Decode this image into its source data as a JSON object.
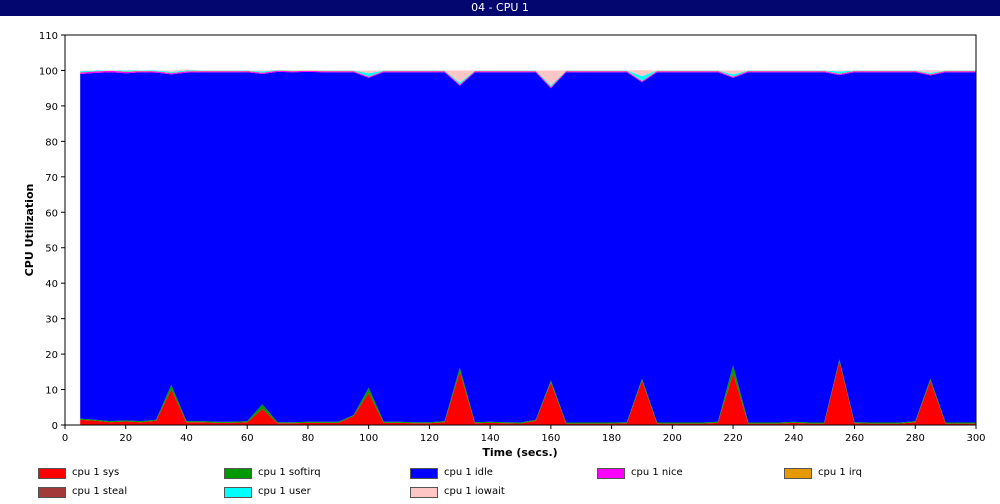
{
  "window": {
    "title": "04 - CPU 1"
  },
  "chart_data": {
    "type": "area",
    "stacked": true,
    "title": "",
    "xlabel": "Time (secs.)",
    "ylabel": "CPU Utilization",
    "xlim": [
      0,
      300
    ],
    "ylim": [
      0,
      110
    ],
    "xticks": [
      0,
      20,
      40,
      60,
      80,
      100,
      120,
      140,
      160,
      180,
      200,
      220,
      240,
      260,
      280,
      300
    ],
    "yticks": [
      0,
      10,
      20,
      30,
      40,
      50,
      60,
      70,
      80,
      90,
      100,
      110
    ],
    "grid": false,
    "legend_position": "bottom",
    "x": [
      5,
      10,
      15,
      20,
      25,
      30,
      35,
      40,
      45,
      50,
      55,
      60,
      65,
      70,
      75,
      80,
      85,
      90,
      95,
      100,
      105,
      110,
      115,
      120,
      125,
      130,
      135,
      140,
      145,
      150,
      155,
      160,
      165,
      170,
      175,
      180,
      185,
      190,
      195,
      200,
      205,
      210,
      215,
      220,
      225,
      230,
      235,
      240,
      245,
      250,
      255,
      260,
      265,
      270,
      275,
      280,
      285,
      290,
      295,
      300
    ],
    "series": [
      {
        "name": "cpu 1 sys",
        "color": "#ff0000",
        "values": [
          1.5,
          1.2,
          0.8,
          1.0,
          0.8,
          1.2,
          10,
          0.8,
          0.8,
          0.6,
          0.6,
          0.8,
          4.5,
          0.5,
          0.5,
          0.6,
          0.6,
          0.6,
          2.5,
          9,
          0.6,
          0.6,
          0.5,
          0.5,
          0.8,
          15,
          0.5,
          0.6,
          0.5,
          0.4,
          1.2,
          12,
          0.4,
          0.4,
          0.4,
          0.4,
          0.5,
          12.5,
          0.4,
          0.4,
          0.4,
          0.4,
          0.6,
          14.5,
          0.4,
          0.4,
          0.4,
          0.6,
          0.4,
          0.4,
          18,
          0.5,
          0.4,
          0.4,
          0.4,
          0.8,
          12.5,
          0.4,
          0.4,
          0.4
        ]
      },
      {
        "name": "cpu 1 softirq",
        "color": "#009900",
        "values": [
          0.3,
          0.3,
          0.3,
          0.3,
          0.3,
          0.3,
          1.3,
          0.3,
          0.3,
          0.3,
          0.3,
          0.3,
          1.3,
          0.3,
          0.3,
          0.3,
          0.3,
          0.3,
          0.3,
          1.5,
          0.3,
          0.3,
          0.3,
          0.3,
          0.3,
          1.2,
          0.3,
          0.3,
          0.3,
          0.3,
          0.3,
          0.6,
          0.3,
          0.3,
          0.3,
          0.3,
          0.3,
          0.6,
          0.3,
          0.3,
          0.3,
          0.3,
          0.3,
          2.3,
          0.3,
          0.3,
          0.3,
          0.3,
          0.3,
          0.3,
          0.5,
          0.3,
          0.3,
          0.3,
          0.3,
          0.3,
          0.6,
          0.3,
          0.3,
          0.3
        ]
      },
      {
        "name": "cpu 1 idle",
        "color": "#0000ff",
        "values": [
          97.2,
          97.8,
          98.4,
          97.9,
          98.4,
          97.9,
          87.6,
          98.3,
          98.4,
          98.6,
          98.6,
          98.4,
          93.2,
          98.8,
          98.7,
          98.7,
          98.6,
          98.6,
          96.7,
          87.4,
          98.6,
          98.6,
          98.7,
          98.7,
          98.4,
          79.5,
          98.7,
          98.6,
          98.7,
          98.8,
          98.0,
          82.4,
          98.8,
          98.8,
          98.8,
          98.8,
          98.7,
          83.6,
          98.8,
          98.8,
          98.8,
          98.8,
          98.6,
          81.1,
          98.8,
          98.8,
          98.8,
          98.6,
          98.8,
          98.8,
          80.2,
          98.7,
          98.8,
          98.8,
          98.8,
          98.4,
          85.5,
          98.8,
          98.8,
          98.8
        ]
      },
      {
        "name": "cpu 1 nice",
        "color": "#ff00ff",
        "values": [
          0.4,
          0.4,
          0.4,
          0.4,
          0.3,
          0.3,
          0.3,
          0.3,
          0.3,
          0.3,
          0.3,
          0.3,
          0.3,
          0.3,
          0.3,
          0.3,
          0.3,
          0.3,
          0.3,
          0.3,
          0.3,
          0.3,
          0.3,
          0.3,
          0.3,
          0.3,
          0.3,
          0.3,
          0.3,
          0.3,
          0.3,
          0.3,
          0.3,
          0.3,
          0.3,
          0.3,
          0.3,
          0.3,
          0.3,
          0.3,
          0.3,
          0.3,
          0.3,
          0.3,
          0.3,
          0.3,
          0.3,
          0.3,
          0.3,
          0.3,
          0.3,
          0.3,
          0.3,
          0.3,
          0.3,
          0.3,
          0.3,
          0.3,
          0.3,
          0.3
        ]
      },
      {
        "name": "cpu 1 irq",
        "color": "#e69900",
        "values": [
          0.1,
          0.1,
          0.1,
          0.1,
          0.1,
          0.1,
          0.1,
          0.1,
          0.1,
          0.1,
          0.1,
          0.1,
          0.1,
          0.1,
          0.1,
          0.1,
          0.1,
          0.1,
          0.1,
          0.1,
          0.1,
          0.1,
          0.1,
          0.1,
          0.1,
          0.1,
          0.1,
          0.1,
          0.1,
          0.1,
          0.1,
          0.1,
          0.1,
          0.1,
          0.1,
          0.1,
          0.1,
          0.1,
          0.1,
          0.1,
          0.1,
          0.1,
          0.1,
          0.1,
          0.1,
          0.1,
          0.1,
          0.1,
          0.1,
          0.1,
          0.1,
          0.1,
          0.1,
          0.1,
          0.1,
          0.1,
          0.1,
          0.1,
          0.1,
          0.1
        ]
      },
      {
        "name": "cpu 1 steal",
        "color": "#a33a3a",
        "values": [
          0,
          0,
          0,
          0,
          0,
          0,
          0,
          0,
          0,
          0,
          0,
          0,
          0,
          0,
          0,
          0,
          0,
          0,
          0,
          0,
          0,
          0,
          0,
          0,
          0,
          0,
          0,
          0,
          0,
          0,
          0,
          0,
          0,
          0,
          0,
          0,
          0,
          0,
          0,
          0,
          0,
          0,
          0,
          0,
          0,
          0,
          0,
          0,
          0,
          0,
          0,
          0,
          0,
          0,
          0,
          0,
          0,
          0,
          0,
          0
        ]
      },
      {
        "name": "cpu 1 user",
        "color": "#00ffff",
        "values": [
          0.3,
          0.2,
          0.0,
          0.3,
          0.1,
          0.2,
          0.3,
          0.2,
          0.1,
          0.1,
          0.1,
          0.1,
          0.3,
          0.1,
          0.1,
          0.0,
          0.1,
          0.1,
          0.1,
          0.9,
          0.1,
          0.1,
          0.1,
          0.1,
          0.1,
          0.5,
          0.1,
          0.1,
          0.1,
          0.1,
          0.1,
          0.4,
          0.1,
          0.1,
          0.1,
          0.1,
          0.1,
          1.3,
          0.1,
          0.1,
          0.1,
          0.1,
          0.1,
          0.6,
          0.1,
          0.1,
          0.1,
          0.1,
          0.1,
          0.1,
          0.6,
          0.1,
          0.1,
          0.1,
          0.1,
          0.1,
          0.3,
          0.1,
          0.1,
          0.1
        ]
      },
      {
        "name": "cpu 1 iowait",
        "color": "#ffc6c6",
        "values": [
          0.2,
          0,
          0,
          0,
          0,
          0,
          0.4,
          0.3,
          0,
          0,
          0,
          0,
          0.3,
          0,
          0,
          0,
          0,
          0,
          0,
          0.8,
          0,
          0,
          0,
          0,
          0,
          3.4,
          0,
          0,
          0,
          0,
          0,
          4.2,
          0,
          0,
          0,
          0,
          0,
          1.7,
          0,
          0,
          0,
          0,
          0,
          1.1,
          0,
          0,
          0,
          0,
          0,
          0,
          0.3,
          0,
          0,
          0,
          0,
          0,
          0.8,
          0,
          0,
          0
        ]
      }
    ]
  }
}
